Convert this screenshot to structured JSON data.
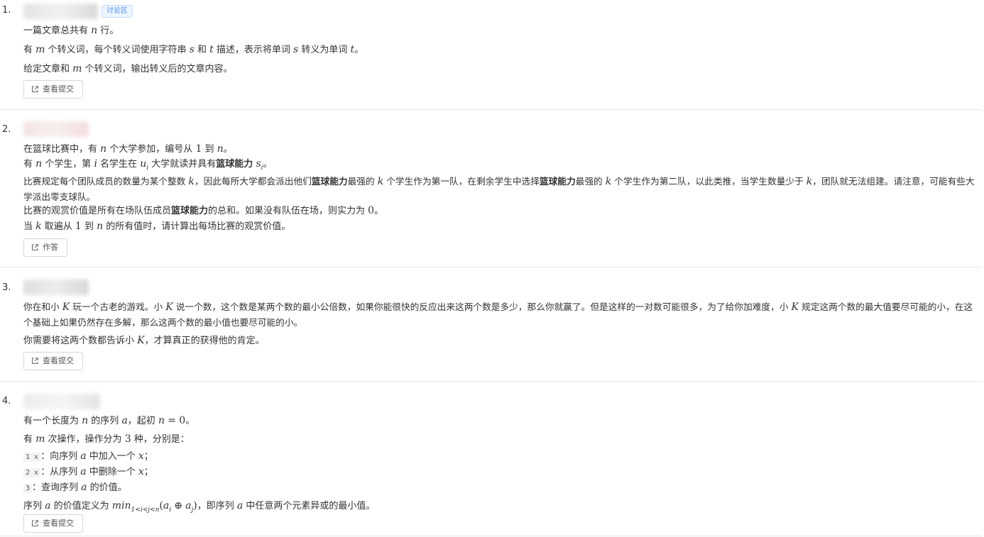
{
  "problems": [
    {
      "number": "1.",
      "tag": "讨论区",
      "lines": [
        "一篇文章总共有 n 行。",
        "有 m 个转义词，每个转义词使用字符串 s 和 t 描述，表示将单词 s 转义为单词 t。",
        "给定文章和 m 个转义词，输出转义后的文章内容。"
      ],
      "button": "查看提交"
    },
    {
      "number": "2.",
      "lines": [
        "在篮球比赛中，有 n 个大学参加，编号从 1 到 n。",
        "有 n 个学生，第 i 名学生在 u_i 大学就读并具有篮球能力 s_i。",
        "比赛规定每个团队成员的数量为某个整数 k，因此每所大学都会派出他们篮球能力最强的 k 个学生作为第一队，在剩余学生中选择篮球能力最强的 k 个学生作为第二队，以此类推，当学生数量少于 k，团队就无法组建。请注意，可能有些大学派出零支球队。",
        "比赛的观赏价值是所有在场队伍成员篮球能力的总和。如果没有队伍在场，则实力为 0。",
        "当 k 取遍从 1 到 n 的所有值时，请计算出每场比赛的观赏价值。"
      ],
      "button": "作答"
    },
    {
      "number": "3.",
      "lines": [
        "你在和小 K 玩一个古老的游戏。小 K 说一个数，这个数是某两个数的最小公倍数，如果你能很快的反应出来这两个数是多少，那么你就赢了。但是这样的一对数可能很多，为了给你加难度，小 K 规定这两个数的最大值要尽可能的小，在这个基础上如果仍然存在多解，那么这两个数的最小值也要尽可能的小。",
        "你需要将这两个数都告诉小 K，才算真正的获得他的肯定。"
      ],
      "button": "查看提交"
    },
    {
      "number": "4.",
      "lines": [
        "有一个长度为 n 的序列 a，起初 n = 0。",
        "有 m 次操作，操作分为 3 种，分别是：",
        "1 x：向序列 a 中加入一个 x；",
        "2 x：从序列 a 中删除一个 x；",
        "3：查询序列 a 的价值。",
        "序列 a 的价值定义为 min_{1<i<j<n}(a_i ⊕ a_j)，即序列 a 中任意两个元素异或的最小值。"
      ],
      "button": "查看提交"
    }
  ],
  "colors": {
    "tag_text": "#4a90e2",
    "tag_bg": "#ecf4ff",
    "divider": "#e6e6e6"
  }
}
